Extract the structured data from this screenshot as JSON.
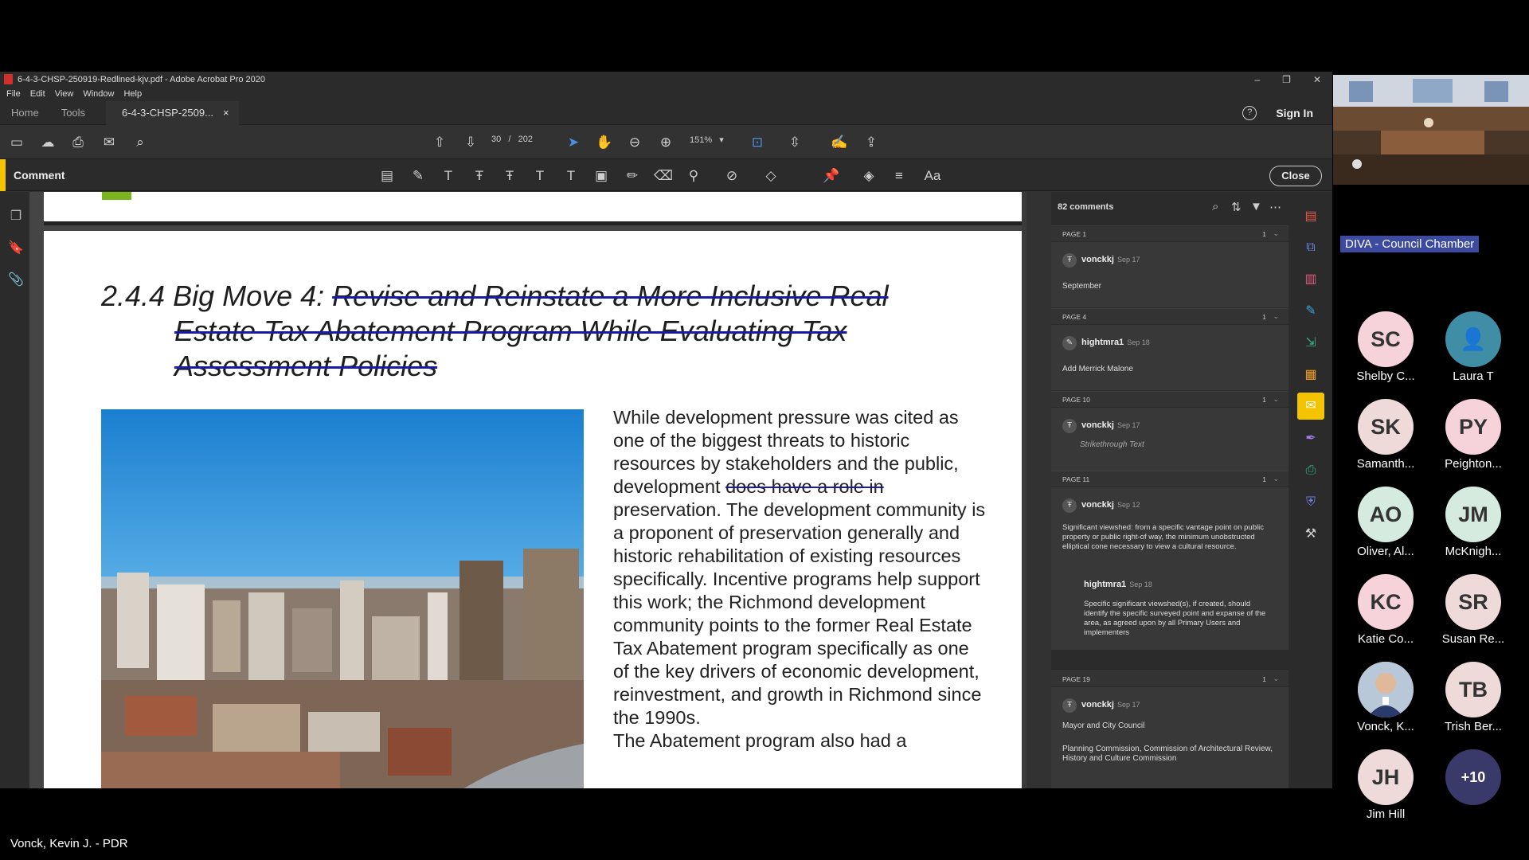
{
  "window": {
    "title": "6-4-3-CHSP-250919-Redlined-kjv.pdf - Adobe Acrobat Pro 2020",
    "controls": [
      "–",
      "❐",
      "✕"
    ]
  },
  "menu": [
    "File",
    "Edit",
    "View",
    "Window",
    "Help"
  ],
  "tabs": {
    "home": "Home",
    "tools": "Tools",
    "doc": "6-4-3-CHSP-2509...",
    "doc_close": "×"
  },
  "account": {
    "help": "?",
    "sign_in": "Sign In"
  },
  "toolbar": {
    "page_current": "30",
    "page_sep": "/",
    "page_total": "202",
    "zoom": "151%"
  },
  "comment_bar": {
    "label": "Comment",
    "close": "Close"
  },
  "document": {
    "heading_prefix": "2.4.4 Big Move 4: ",
    "heading_struck_1": "Revise and Reinstate a More Inclusive Real",
    "heading_struck_2": "Estate Tax Abatement Program While Evaluating Tax",
    "heading_struck_3": "Assessment Policies",
    "body_1": "While development pressure was cited as one of the biggest threats to historic resources by stakeholders and the public, development ",
    "body_deleted": "does have a role in",
    "body_2": " preservation. The development community is a proponent of preservation generally and historic rehabilitation of existing resources specifically. Incentive programs help support this work; the Richmond development community points to the former Real Estate Tax Abatement program specifically as one of the key drivers of economic development, reinvestment, and growth in Richmond since the 1990s.",
    "body_3": "The Abatement program also had a"
  },
  "comments": {
    "count": "82 comments",
    "pages": [
      {
        "label": "PAGE 1",
        "count": "1",
        "author": "vonckkj",
        "date": "Sep 17",
        "text": "September"
      },
      {
        "label": "PAGE 4",
        "count": "1",
        "author": "hightmra1",
        "date": "Sep 18",
        "text": "Add Merrick Malone"
      },
      {
        "label": "PAGE 10",
        "count": "1",
        "author": "vonckkj",
        "date": "Sep 17",
        "text": "Strikethrough Text"
      },
      {
        "label": "PAGE 11",
        "count": "1",
        "author": "vonckkj",
        "date": "Sep 12",
        "text": "Significant viewshed: from a specific vantage point on public property or public right-of way, the minimum unobstructed elliptical cone necessary to view a cultural resource.",
        "reply_author": "hightmra1",
        "reply_date": "Sep 18",
        "reply_text": "Specific significant viewshed(s), if created, should identify the specific surveyed point and expanse of the area, as agreed upon by all Primary Users and implementers"
      },
      {
        "label": "PAGE 19",
        "count": "1",
        "author": "vonckkj",
        "date": "Sep 17",
        "text": "Mayor and City Council",
        "text2": "Planning Commission, Commission of Architectural Review, History and Culture Commission"
      }
    ]
  },
  "zoom": {
    "room_label": "DIVA - Council Chamber",
    "participants": [
      {
        "initials": "SC",
        "name": "Shelby C...",
        "color": "#f6d3da"
      },
      {
        "initials": "",
        "name": "Laura T",
        "color": "#3f8ea5"
      },
      {
        "initials": "SK",
        "name": "Samanth...",
        "color": "#efdada"
      },
      {
        "initials": "PY",
        "name": "Peighton...",
        "color": "#f6d3da"
      },
      {
        "initials": "AO",
        "name": "Oliver, Al...",
        "color": "#d5ebe0"
      },
      {
        "initials": "JM",
        "name": "McKnigh...",
        "color": "#d5ebe0"
      },
      {
        "initials": "KC",
        "name": "Katie Co...",
        "color": "#f6d3da"
      },
      {
        "initials": "SR",
        "name": "Susan Re...",
        "color": "#efdada"
      },
      {
        "initials": "",
        "name": "Vonck, K...",
        "color": "#c9d4e0"
      },
      {
        "initials": "TB",
        "name": "Trish Ber...",
        "color": "#efdada"
      },
      {
        "initials": "JH",
        "name": "Jim Hill",
        "color": "#efdada"
      },
      {
        "initials": "+10",
        "name": "",
        "color": "#3a3a6a"
      }
    ],
    "speaker": "Vonck, Kevin J. - PDR"
  }
}
